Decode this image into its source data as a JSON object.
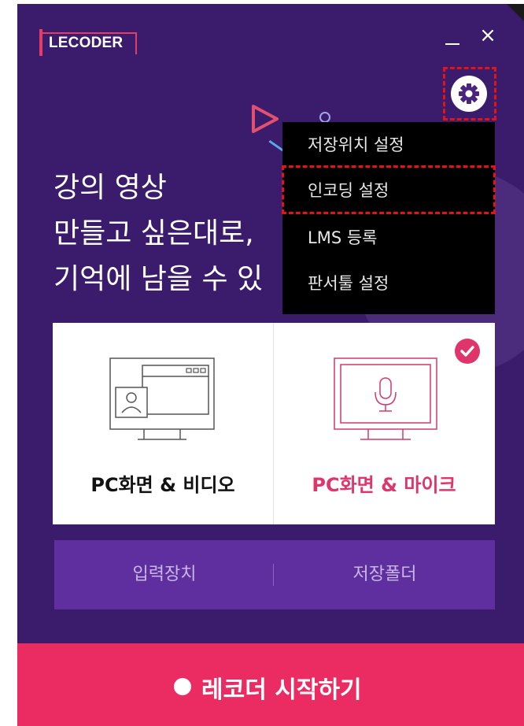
{
  "app": {
    "logo_text": "LECODER"
  },
  "window_controls": {
    "minimize": "minimize-icon",
    "close": "×"
  },
  "headline": {
    "line1": "강의 영상",
    "line2": "만들고 싶은대로,",
    "line3": "기억에 남을 수 있"
  },
  "settings_menu": {
    "items": [
      {
        "label": "저장위치 설정"
      },
      {
        "label": "인코딩 설정"
      },
      {
        "label": "LMS 등록"
      },
      {
        "label": "판서툴 설정"
      }
    ]
  },
  "modes": [
    {
      "label": "PC화면 & 비디오",
      "icon": "pc-video-icon",
      "selected": false
    },
    {
      "label": "PC화면 & 마이크",
      "icon": "pc-mic-icon",
      "selected": true
    }
  ],
  "bottom_buttons": {
    "input_device": "입력장치",
    "save_folder": "저장폴더"
  },
  "record_button": {
    "label": "레코더 시작하기"
  },
  "colors": {
    "background": "#3b1b6b",
    "accent": "#ea2c63",
    "menu_bg": "#000000",
    "highlight_dash": "#e31414",
    "bottom_bar": "#5f2fa0"
  }
}
